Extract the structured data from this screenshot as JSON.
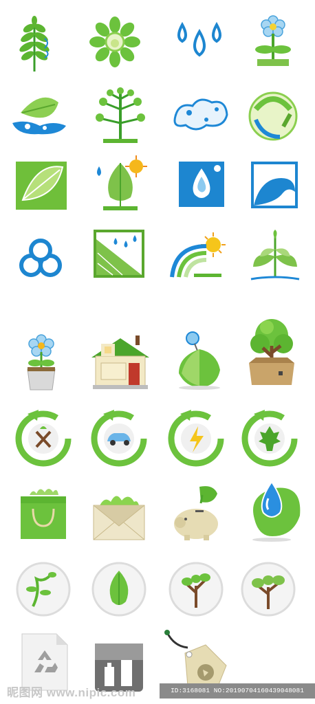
{
  "watermark": {
    "site_text": "昵图网 www.nipic.com",
    "id_text": "ID:3168081 NO:20190704160439048081"
  },
  "icons": [
    "fern-leaf-icon",
    "green-flower-sun-icon",
    "water-drops-icon",
    "blue-flower-icon",
    "leaf-splash-icon",
    "tree-icon",
    "cloud-splash-icon",
    "recycle-globe-icon",
    "leaf-square-icon",
    "leaf-sun-icon",
    "drop-square-icon",
    "wave-square-icon",
    "water-bubbles-icon",
    "rain-field-square-icon",
    "rainbow-sun-icon",
    "plant-sprout-icon",
    "potted-flower-icon",
    "house-icon",
    "leaf-bulb-icon",
    "tree-box-icon",
    "recycle-tree-icon",
    "recycle-car-icon",
    "recycle-lightning-icon",
    "recycle-leaf-icon",
    "shopping-bag-icon",
    "envelope-icon",
    "piggy-bank-icon",
    "leaf-drop-icon",
    "vine-orb-icon",
    "leaf-orb-icon",
    "tree-orb-icon",
    "tree-orb-2-icon",
    "recycle-document-icon",
    "recycle-bin-icon",
    "eco-tag-icon"
  ]
}
